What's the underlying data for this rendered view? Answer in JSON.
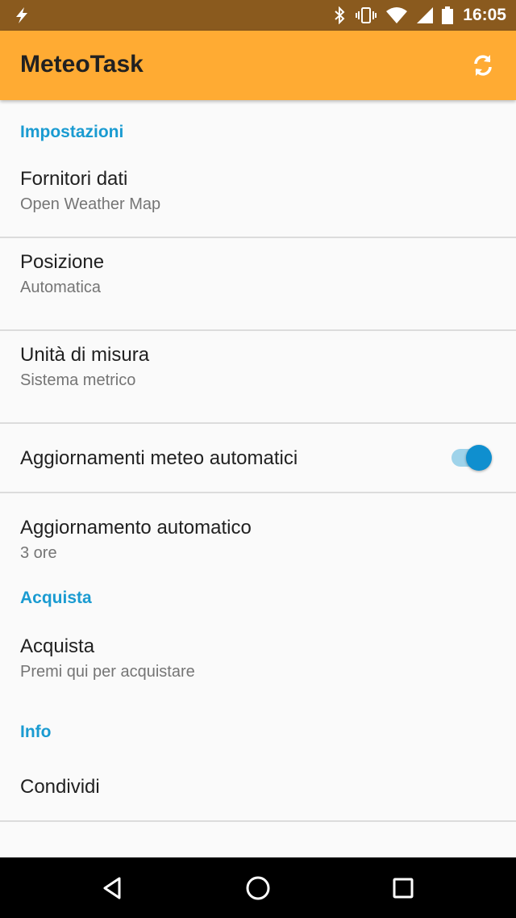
{
  "status_bar": {
    "time": "16:05",
    "icons": [
      "flash-icon",
      "bluetooth-icon",
      "vibrate-icon",
      "wifi-icon",
      "signal-icon",
      "battery-icon"
    ]
  },
  "app_bar": {
    "title": "MeteoTask",
    "action_icon": "refresh-icon",
    "color": "#ffab33"
  },
  "sections": {
    "settings": {
      "header": "Impostazioni",
      "items": [
        {
          "title": "Fornitori dati",
          "summary": "Open Weather Map"
        },
        {
          "title": "Posizione",
          "summary": "Automatica"
        },
        {
          "title": "Unità di misura",
          "summary": "Sistema metrico"
        },
        {
          "title": "Aggiornamenti meteo automatici",
          "toggle": true
        },
        {
          "title": "Aggiornamento automatico",
          "summary": "3 ore"
        }
      ]
    },
    "buy": {
      "header": "Acquista",
      "items": [
        {
          "title": "Acquista",
          "summary": "Premi qui per acquistare"
        }
      ]
    },
    "info": {
      "header": "Info",
      "items": [
        {
          "title": "Condividi"
        }
      ]
    }
  },
  "colors": {
    "accent": "#1a9bd1",
    "toggle_on": "#0f8fcf"
  },
  "nav_bar": {
    "buttons": [
      "back-icon",
      "home-icon",
      "recents-icon"
    ]
  }
}
